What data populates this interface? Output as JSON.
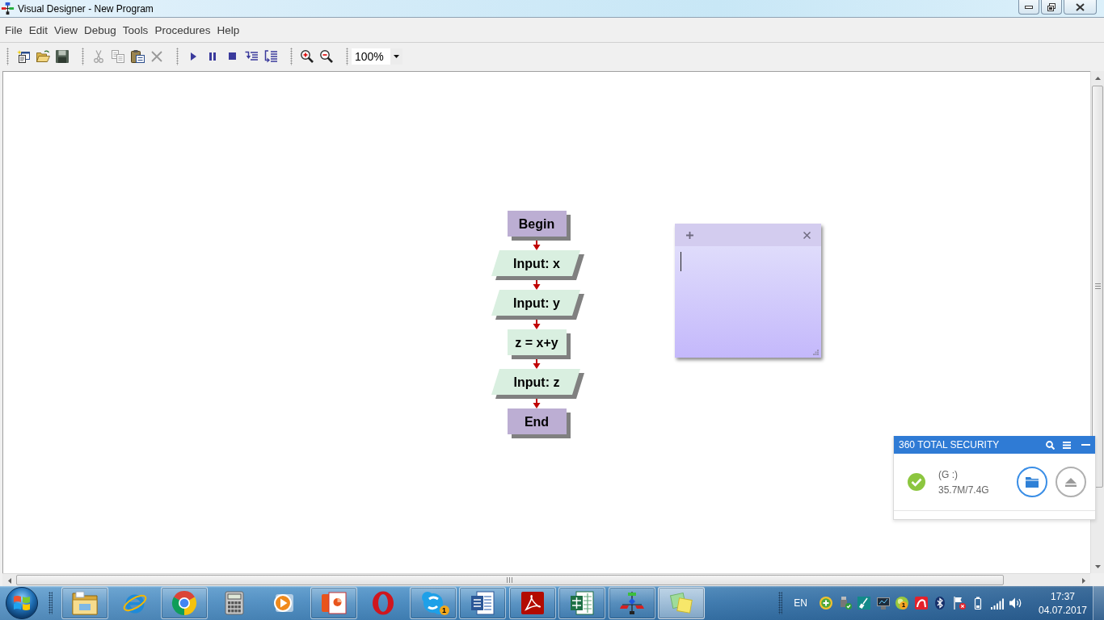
{
  "window": {
    "title": "Visual Designer - New Program"
  },
  "menu": [
    "File",
    "Edit",
    "View",
    "Debug",
    "Tools",
    "Procedures",
    "Help"
  ],
  "toolbar": {
    "groups": [
      {
        "buttons": [
          {
            "kind": "new",
            "disabled": false
          },
          {
            "kind": "open",
            "disabled": false
          },
          {
            "kind": "save",
            "disabled": false
          }
        ]
      },
      {
        "buttons": [
          {
            "kind": "cut",
            "disabled": true
          },
          {
            "kind": "copy",
            "disabled": true
          },
          {
            "kind": "paste",
            "disabled": false
          },
          {
            "kind": "delete",
            "disabled": true
          }
        ]
      },
      {
        "buttons": [
          {
            "kind": "run",
            "disabled": false
          },
          {
            "kind": "pause",
            "disabled": false
          },
          {
            "kind": "stop",
            "disabled": false
          },
          {
            "kind": "step_into",
            "disabled": false
          },
          {
            "kind": "step_over",
            "disabled": false
          }
        ]
      },
      {
        "buttons": [
          {
            "kind": "zoom_in",
            "disabled": false
          },
          {
            "kind": "zoom_out",
            "disabled": false
          }
        ]
      }
    ],
    "zoom": {
      "value": "100%"
    }
  },
  "canvas": {
    "flowchart": {
      "nodes": [
        {
          "kind": "terminal",
          "label": "Begin"
        },
        {
          "kind": "io",
          "label": "Input: x"
        },
        {
          "kind": "io",
          "label": "Input: y"
        },
        {
          "kind": "process",
          "label": "z = x+y"
        },
        {
          "kind": "io",
          "label": "Input: z"
        },
        {
          "kind": "terminal",
          "label": "End"
        }
      ]
    }
  },
  "security_popup": {
    "title": "360 TOTAL SECURITY",
    "drive": {
      "label": "(G :)",
      "usage": "35.7M/7.4G"
    }
  },
  "taskbar": {
    "apps": [
      {
        "kind": "folder",
        "running": true,
        "selected": false
      },
      {
        "kind": "orbit_browser",
        "running": false,
        "selected": false
      },
      {
        "kind": "wheel_browser",
        "running": true,
        "selected": false
      },
      {
        "kind": "calculator",
        "running": false,
        "selected": false
      },
      {
        "kind": "media_player",
        "running": false,
        "selected": false
      },
      {
        "kind": "presentation",
        "running": true,
        "selected": false
      },
      {
        "kind": "ring_browser",
        "running": false,
        "selected": false
      },
      {
        "kind": "chat",
        "running": true,
        "selected": false,
        "badge": "1"
      },
      {
        "kind": "document",
        "running": true,
        "selected": false
      },
      {
        "kind": "pdf",
        "running": true,
        "selected": false
      },
      {
        "kind": "spreadsheet",
        "running": true,
        "selected": false
      },
      {
        "kind": "flowchart",
        "running": true,
        "selected": false
      },
      {
        "kind": "sticky_notes",
        "running": true,
        "selected": true
      }
    ],
    "tray": {
      "language": "EN",
      "icons": [
        {
          "kind": "plus_circle"
        },
        {
          "kind": "usb"
        },
        {
          "kind": "brush"
        },
        {
          "kind": "monitor"
        },
        {
          "kind": "orb",
          "badge": "1"
        },
        {
          "kind": "umbrella"
        },
        {
          "kind": "bluetooth"
        },
        {
          "kind": "flag"
        },
        {
          "kind": "battery"
        },
        {
          "kind": "signal"
        },
        {
          "kind": "speaker"
        }
      ],
      "clock": {
        "time": "17:37",
        "date": "04.07.2017"
      }
    }
  }
}
